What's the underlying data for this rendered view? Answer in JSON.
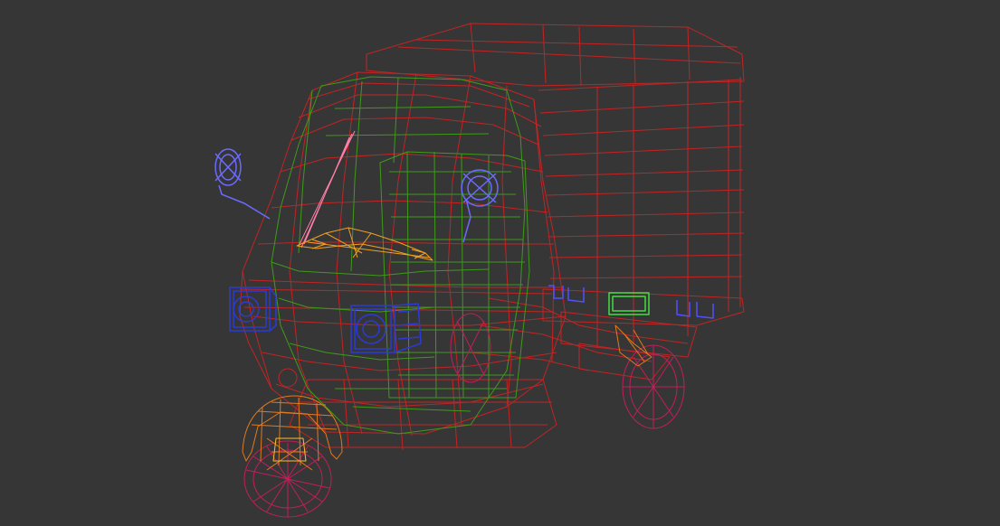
{
  "viewport": {
    "background": "#363636",
    "model_name": "auto-rickshaw-cargo-wireframe"
  },
  "colors": {
    "body_wire": "#c22424",
    "cabin_wire": "#3f9a1a",
    "mirror_wire": "#6b6bff",
    "headlight_wire": "#2a3bd6",
    "wheel_wire": "#e07a1e",
    "rear_wheel_wire": "#c21e5a",
    "wiper_wire": "#ff7fa8",
    "dashboard_wire": "#f0a020",
    "plate_wire": "#44dd44"
  }
}
